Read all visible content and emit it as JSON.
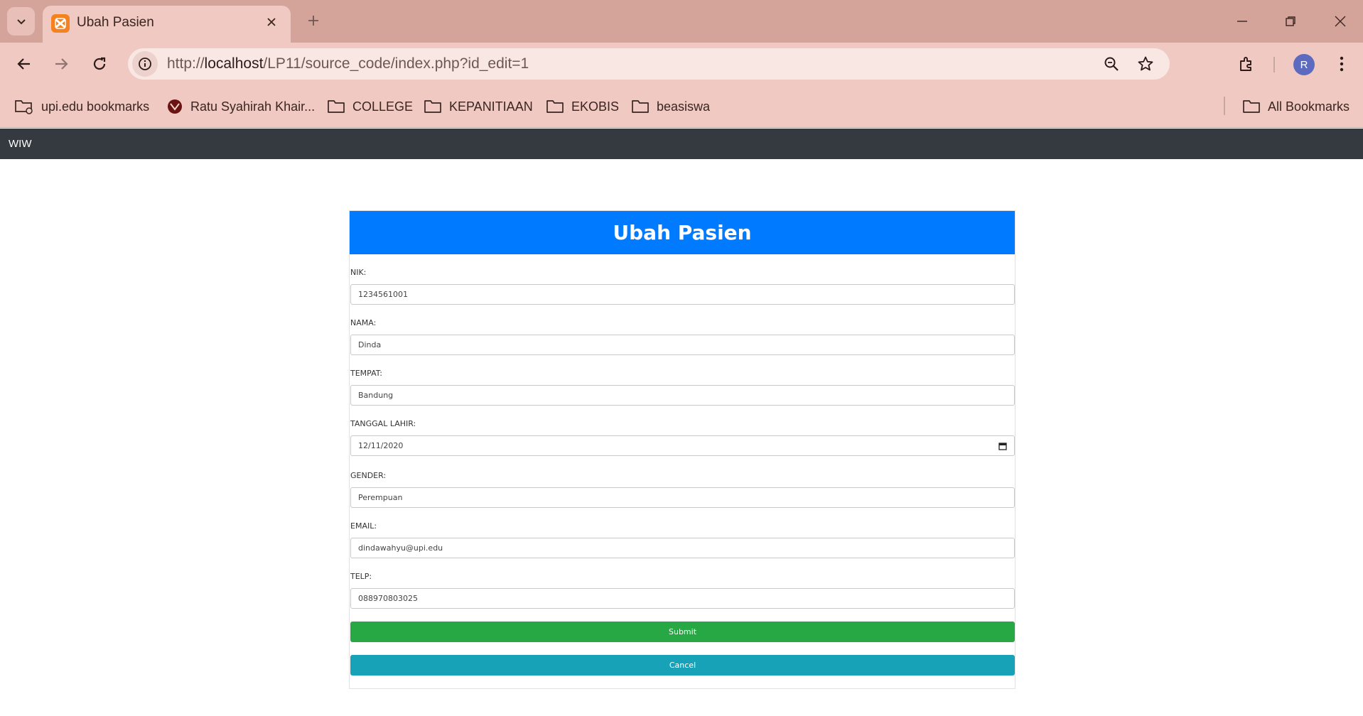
{
  "browser": {
    "tab_title": "Ubah Pasien",
    "url_prefix": "http://",
    "url_host": "localhost",
    "url_path": "/LP11/source_code/index.php?id_edit=1",
    "profile_initial": "R",
    "bookmarks": [
      {
        "label": "upi.edu bookmarks",
        "icon": "managed-folder-icon"
      },
      {
        "label": "Ratu Syahirah Khair...",
        "icon": "site-favicon"
      },
      {
        "label": "COLLEGE",
        "icon": "folder-icon"
      },
      {
        "label": "KEPANITIAAN",
        "icon": "folder-icon"
      },
      {
        "label": "EKOBIS",
        "icon": "folder-icon"
      },
      {
        "label": "beasiswa",
        "icon": "folder-icon"
      }
    ],
    "all_bookmarks": "All Bookmarks"
  },
  "navbar": {
    "brand": "WIW"
  },
  "form": {
    "title": "Ubah Pasien",
    "fields": [
      {
        "label": "NIK:",
        "value": "1234561001"
      },
      {
        "label": "NAMA:",
        "value": "Dinda"
      },
      {
        "label": "TEMPAT:",
        "value": "Bandung"
      },
      {
        "label": "TANGGAL LAHIR:",
        "value": "12/11/2020"
      },
      {
        "label": "GENDER:",
        "value": "Perempuan"
      },
      {
        "label": "EMAIL:",
        "value": "dindawahyu@upi.edu"
      },
      {
        "label": "TELP:",
        "value": "088970803025"
      }
    ],
    "submit_label": "Submit",
    "cancel_label": "Cancel"
  },
  "colors": {
    "header": "#007bff",
    "submit": "#28a745",
    "cancel": "#17a2b8",
    "navbar": "#343a40",
    "chrome": "#f0c9c2"
  }
}
